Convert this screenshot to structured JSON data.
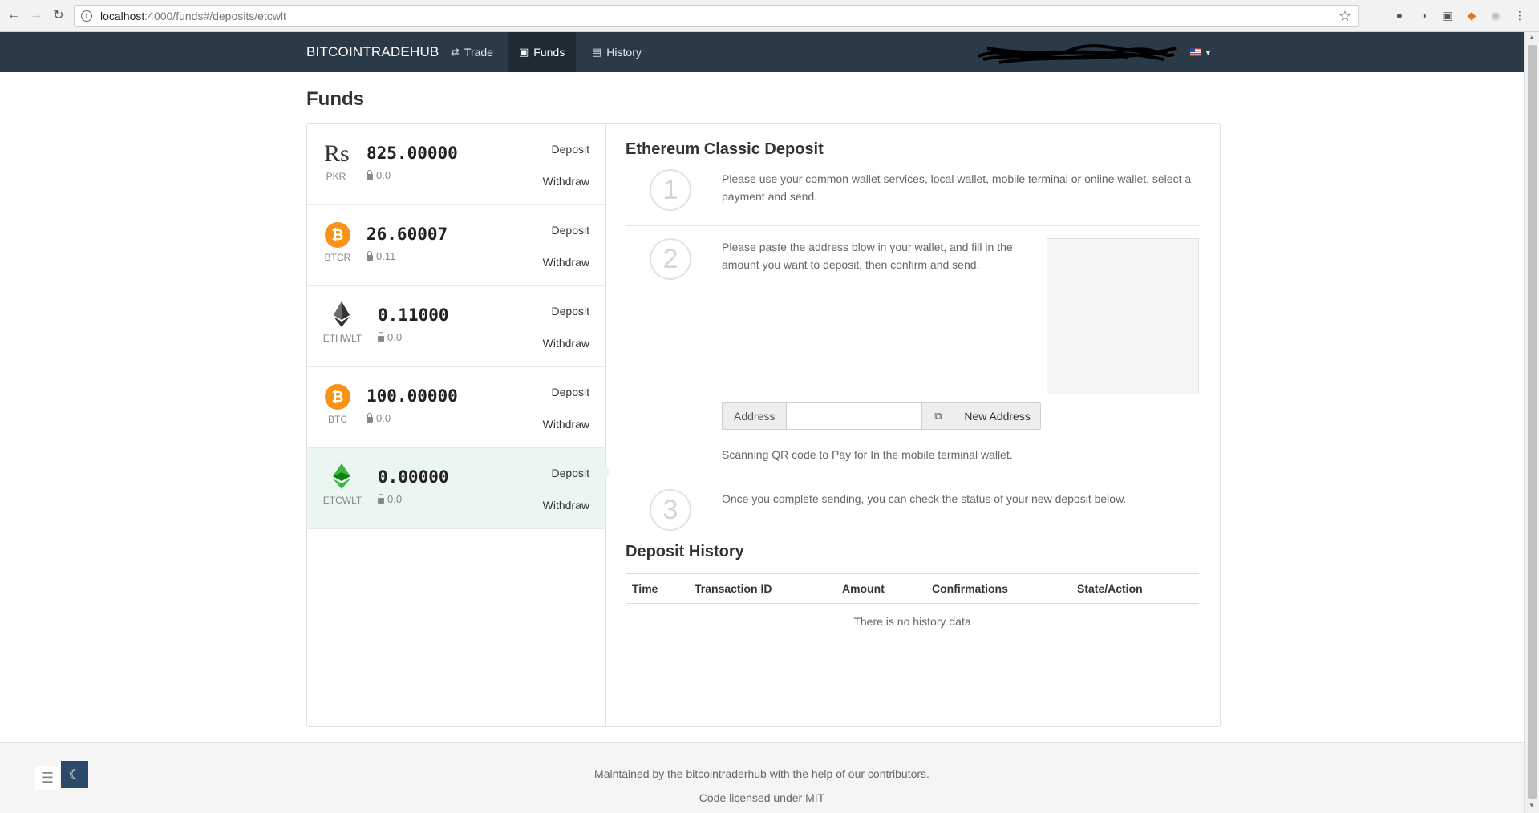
{
  "browser": {
    "url_host": "localhost",
    "url_path": ":4000/funds#/deposits/etcwlt"
  },
  "navbar": {
    "brand": "BITCOINTRADEHUB",
    "items": [
      {
        "label": "Trade",
        "icon": "exchange-icon"
      },
      {
        "label": "Funds",
        "icon": "money-icon"
      },
      {
        "label": "History",
        "icon": "book-icon"
      }
    ]
  },
  "page": {
    "title": "Funds"
  },
  "funds": [
    {
      "code": "PKR",
      "balance": "825.00000",
      "locked": "0.0",
      "icon": "rupee-icon",
      "deposit": "Deposit",
      "withdraw": "Withdraw"
    },
    {
      "code": "BTCR",
      "balance": "26.60007",
      "locked": "0.11",
      "icon": "bitcoin-icon",
      "deposit": "Deposit",
      "withdraw": "Withdraw"
    },
    {
      "code": "ETHWLT",
      "balance": "0.11000",
      "locked": "0.0",
      "icon": "ethereum-icon",
      "deposit": "Deposit",
      "withdraw": "Withdraw"
    },
    {
      "code": "BTC",
      "balance": "100.00000",
      "locked": "0.0",
      "icon": "bitcoin-icon",
      "deposit": "Deposit",
      "withdraw": "Withdraw"
    },
    {
      "code": "ETCWLT",
      "balance": "0.00000",
      "locked": "0.0",
      "icon": "ethereum-classic-icon",
      "deposit": "Deposit",
      "withdraw": "Withdraw"
    }
  ],
  "deposit": {
    "title": "Ethereum Classic Deposit",
    "steps": [
      {
        "num": "1",
        "text": "Please use your common wallet services, local wallet, mobile terminal or online wallet, select a payment and send."
      },
      {
        "num": "2",
        "text": "Please paste the address blow in your wallet, and fill in the amount you want to deposit, then confirm and send."
      },
      {
        "num": "3",
        "text": "Once you complete sending, you can check the status of your new deposit below."
      }
    ],
    "address_label": "Address",
    "address_value": "",
    "new_address_label": "New Address",
    "qr_note": "Scanning QR code to Pay for In the mobile terminal wallet."
  },
  "history": {
    "title": "Deposit History",
    "columns": [
      "Time",
      "Transaction ID",
      "Amount",
      "Confirmations",
      "State/Action"
    ],
    "empty": "There is no history data"
  },
  "footer": {
    "line1": "Maintained by the bitcointraderhub with the help of our contributors.",
    "line2": "Code licensed under MIT"
  },
  "colors": {
    "navbar": "#2b3a47",
    "bitcoin": "#f7931a",
    "etc_green": "#3ab83a",
    "selected_row": "#ecf6f1"
  }
}
